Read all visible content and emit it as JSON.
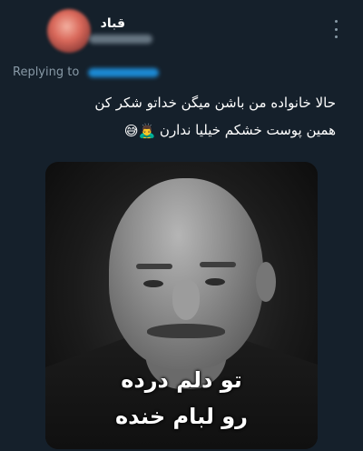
{
  "tweet": {
    "author_name": "قباد",
    "reply_label": "Replying to",
    "text_line1": "حالا خانواده من باشن میگن خداتو شکر کن",
    "text_line2": "همین پوست خشکم خیلیا ندارن",
    "emoji_1": "🙇‍♂️",
    "emoji_2": "😅"
  },
  "media": {
    "caption_line1": "تو دلم درده",
    "caption_line2": "رو لبام خنده"
  },
  "colors": {
    "background": "#15202b",
    "muted_text": "#8899a6",
    "link": "#1d9bf0"
  }
}
